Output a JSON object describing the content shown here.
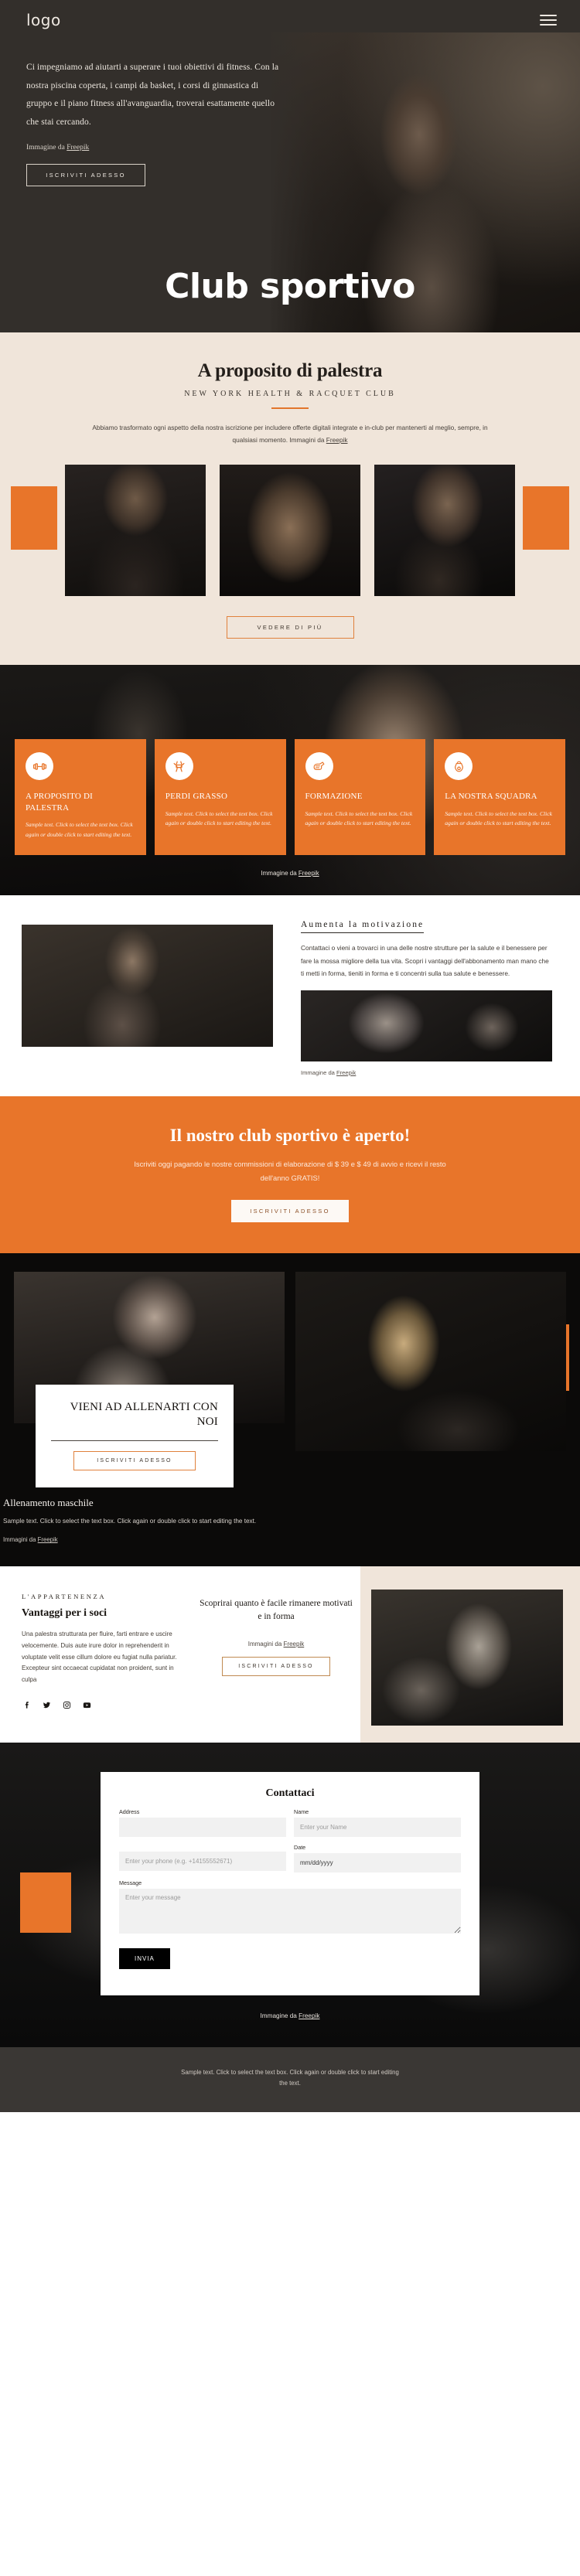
{
  "hero": {
    "logo": "logo",
    "menu_icon": "hamburger-menu-icon",
    "paragraph": "Ci impegniamo ad aiutarti a superare i tuoi obiettivi di fitness. Con la nostra piscina coperta, i campi da basket, i corsi di ginnastica di gruppo e il piano fitness all'avanguardia, troverai esattamente quello che stai cercando.",
    "credit_prefix": "Immagine da ",
    "credit_link": "Freepik",
    "cta": "ISCRIVITI ADESSO",
    "title": "Club sportivo"
  },
  "about": {
    "title": "A proposito di palestra",
    "subtitle": "NEW YORK HEALTH & RACQUET CLUB",
    "paragraph_1": "Abbiamo trasformato ogni aspetto della nostra iscrizione per includere offerte digitali integrate e in-club per mantenerti al meglio, sempre, in qualsiasi momento. Immagini da ",
    "credit_link": "Freepik",
    "cta": "VEDERE DI PIÙ"
  },
  "features": {
    "cards": [
      {
        "icon": "dumbbell-icon",
        "title": "A PROPOSITO DI PALESTRA",
        "text": "Sample text. Click to select the text box. Click again or double click to start editing the text."
      },
      {
        "icon": "waist-measure-icon",
        "title": "PERDI GRASSO",
        "text": "Sample text. Click to select the text box. Click again or double click to start editing the text."
      },
      {
        "icon": "gym-glove-icon",
        "title": "FORMAZIONE",
        "text": "Sample text. Click to select the text box. Click again or double click to start editing the text."
      },
      {
        "icon": "kettlebell-icon",
        "title": "LA NOSTRA SQUADRA",
        "text": "Sample text. Click to select the text box. Click again or double click to start editing the text."
      }
    ],
    "credit_prefix": "Immagine da ",
    "credit_link": "Freepik"
  },
  "motivation": {
    "title": "Aumenta la motivazione",
    "paragraph": "Contattaci o vieni a trovarci in una delle nostre strutture per la salute e il benessere per fare la mossa migliore della tua vita. Scopri i vantaggi dell'abbonamento man mano che ti metti in forma, tieniti in forma e ti concentri sulla tua salute e benessere.",
    "credit_prefix": "Immagine da ",
    "credit_link": "Freepik"
  },
  "cta_band": {
    "title": "Il nostro club sportivo è aperto!",
    "paragraph": "Iscriviti oggi pagando le nostre commissioni di elaborazione di $ 39 e $ 49 di avvio e ricevi il resto dell'anno GRATIS!",
    "button": "ISCRIVITI ADESSO"
  },
  "train": {
    "panel_title": "VIENI AD ALLENARTI CON NOI",
    "panel_button": "ISCRIVITI ADESSO",
    "right_title": "Allenamento maschile",
    "right_text": "Sample text. Click to select the text box. Click again or double click to start editing the text.",
    "credit_prefix": "Immagini da ",
    "credit_link": "Freepik"
  },
  "membership": {
    "eyebrow": "L'APPARTENENZA",
    "title": "Vantaggi per i soci",
    "paragraph": "Una palestra strutturata per fluire, farti entrare e uscire velocemente. Duis aute irure dolor in reprehenderit in voluptate velit esse cillum dolore eu fugiat nulla pariatur. Excepteur sint occaecat cupidatat non proident, sunt in culpa",
    "social": [
      "facebook-icon",
      "twitter-icon",
      "instagram-icon",
      "youtube-icon"
    ],
    "mid_title": "Scoprirai quanto è facile rimanere motivati e in forma",
    "credit_prefix": "Immagini da ",
    "credit_link": "Freepik",
    "button": "ISCRIVITI ADESSO"
  },
  "contact": {
    "title": "Contattaci",
    "fields": {
      "address_label": "Address",
      "address_value": "",
      "address_placeholder": "",
      "name_label": "Name",
      "name_placeholder": "Enter your Name",
      "phone_placeholder": "Enter your phone (e.g. +14155552671)",
      "date_label": "Date",
      "date_value": "mm/dd/yyyy",
      "message_label": "Message",
      "message_placeholder": "Enter your message"
    },
    "submit": "INVIA",
    "credit_prefix": "Immagine da ",
    "credit_link": "Freepik"
  },
  "footer": {
    "text": "Sample text. Click to select the text box. Click again or double click to start editing the text."
  },
  "colors": {
    "orange": "#e8752a",
    "dark": "#332f2b",
    "beige": "#f0e5da",
    "footer": "#3a3734"
  }
}
